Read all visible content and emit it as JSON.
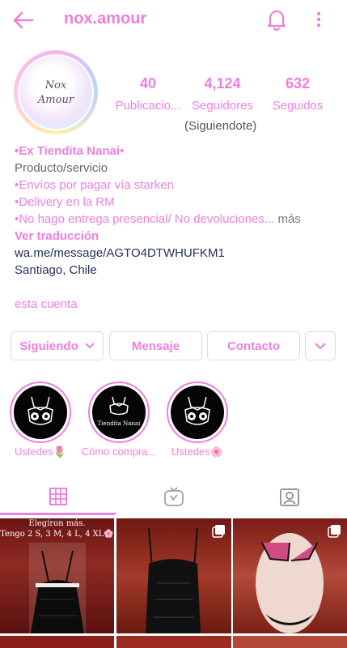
{
  "header": {
    "username": "nox.amour",
    "back_icon": "arrow-left-icon",
    "notify_icon": "bell-icon",
    "menu_icon": "more-vertical-icon"
  },
  "profile": {
    "avatar_text_line1": "Nox",
    "avatar_text_line2": "Amour",
    "stats": [
      {
        "value": "40",
        "label": "Publicacio..."
      },
      {
        "value": "4,124",
        "label": "Seguidores"
      },
      {
        "value": "632",
        "label": "Seguidos"
      }
    ],
    "follows_you": "(Siguiendote)"
  },
  "bio": {
    "name": "•Ex Tiendita Nanai•",
    "category": "Producto/servicio",
    "line1": "•Envíos por pagar vía starken",
    "line2": "•Delivery en la RM",
    "line3": "•No hago entrega presencial/ No devoluciones...",
    "more": "más",
    "translate": "Ver traducción",
    "link": "wa.me/message/AGTO4DTWHUFKM1",
    "location": "Santiago, Chile",
    "account_link": "esta cuenta"
  },
  "actions": {
    "following": "Siguiendo",
    "message": "Mensaje",
    "contact": "Contacto"
  },
  "highlights": [
    {
      "label": "Ustedes🌷",
      "inner_text": ""
    },
    {
      "label": "Cómo compra...",
      "inner_text": "Tiendita Nanai"
    },
    {
      "label": "Ustedes🌸",
      "inner_text": ""
    }
  ],
  "tabs": [
    "grid-icon",
    "igtv-icon",
    "tagged-icon"
  ],
  "posts": [
    {
      "caption_line1": "Elegiron más.",
      "caption_line2": "Tengo 2 S, 3 M, 4 L, 4 XL🌸"
    }
  ],
  "colors": {
    "accent": "#ee7fe0",
    "border": "#dcdcdc"
  }
}
